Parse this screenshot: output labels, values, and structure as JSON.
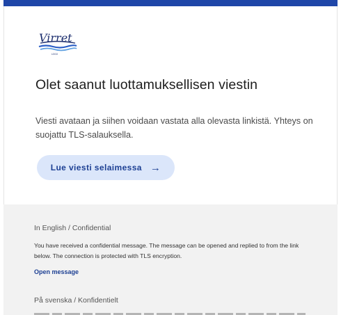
{
  "header": {
    "logo_text": "Virret",
    "logo_subtext": "LOGO"
  },
  "main": {
    "heading": "Olet saanut luottamuksellisen viestin",
    "body": "Viesti avataan ja siihen voidaan vastata alla olevasta linkistä. Yhteys on suojattu TLS-salauksella.",
    "cta_label": "Lue viesti selaimessa",
    "cta_icon": "arrow-right-icon"
  },
  "footer": {
    "english": {
      "title": "In English / Confidential",
      "text": "You have received a confidential message. The message can be opened and replied to from the link below. The connection is protected with TLS encryption.",
      "link": "Open message"
    },
    "swedish": {
      "title": "På svenska / Konfidentielt"
    }
  },
  "colors": {
    "brand_bar": "#1f46a8",
    "cta_background": "#dbe6fa",
    "cta_text": "#1c3f93",
    "footer_background": "#f2f2f2"
  }
}
